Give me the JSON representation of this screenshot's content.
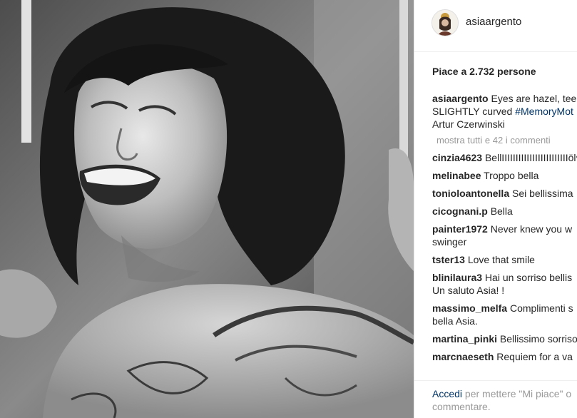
{
  "post": {
    "username": "asiaargento",
    "likes_text": "Piace a 2.732 persone",
    "caption": {
      "username": "asiaargento",
      "text_before": "Eyes are hazel, tee",
      "text_mid": "SLIGHTLY curved ",
      "hashtag": "#MemoryMot",
      "text_after": "Artur Czerwinski"
    },
    "more_comments": "mostra tutti e 42 i commenti",
    "comments": [
      {
        "user": "cinzia4623",
        "text": "BellIIIIIIIIIIIIIIIIIIIIIIIIöl♥"
      },
      {
        "user": "melinabee",
        "text": "Troppo bella"
      },
      {
        "user": "tonioloantonella",
        "text": "Sei bellissima"
      },
      {
        "user": "cicognani.p",
        "text": "Bella"
      },
      {
        "user": "painter1972",
        "text": "Never knew you w",
        "text2": "swinger"
      },
      {
        "user": "tster13",
        "text": "Love that smile"
      },
      {
        "user": "blinilaura3",
        "text": "Hai un sorriso bellis",
        "text2": "Un saluto Asia! !"
      },
      {
        "user": "massimo_melfa",
        "text": "Complimenti s",
        "text2": "bella Asia."
      },
      {
        "user": "martina_pinki",
        "text": "Bellissimo sorriso"
      },
      {
        "user": "marcnaeseth",
        "text": "Requiem for a va"
      }
    ],
    "footer": {
      "login_link": "Accedi",
      "text": " per mettere \"Mi piace\" o",
      "text2": "commentare."
    }
  }
}
